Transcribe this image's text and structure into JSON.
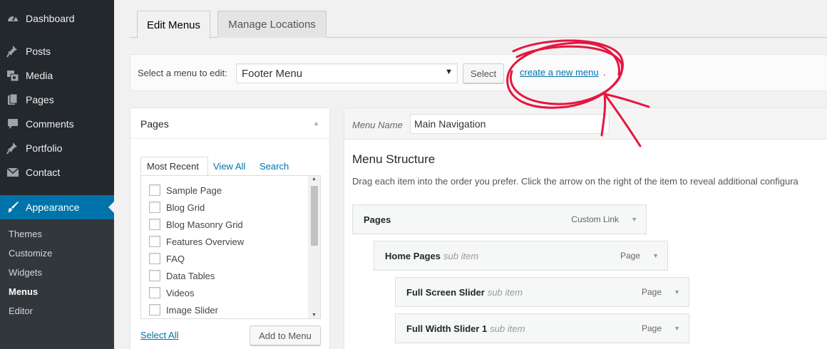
{
  "sidebar": {
    "items": [
      {
        "label": "Dashboard",
        "icon": "dashboard-icon"
      },
      {
        "label": "Posts",
        "icon": "pin-icon"
      },
      {
        "label": "Media",
        "icon": "media-icon"
      },
      {
        "label": "Pages",
        "icon": "pages-icon"
      },
      {
        "label": "Comments",
        "icon": "comment-icon"
      },
      {
        "label": "Portfolio",
        "icon": "pin-icon"
      },
      {
        "label": "Contact",
        "icon": "envelope-icon"
      },
      {
        "label": "Appearance",
        "icon": "brush-icon",
        "active": true
      }
    ],
    "submenu": [
      {
        "label": "Themes"
      },
      {
        "label": "Customize"
      },
      {
        "label": "Widgets"
      },
      {
        "label": "Menus",
        "current": true
      },
      {
        "label": "Editor"
      }
    ]
  },
  "tabs": [
    {
      "label": "Edit Menus",
      "active": true
    },
    {
      "label": "Manage Locations",
      "active": false
    }
  ],
  "manage": {
    "label": "Select a menu to edit:",
    "selected": "Footer Menu",
    "select_button": "Select",
    "create_link": "create a new menu",
    "create_suffix": "."
  },
  "pages_panel": {
    "title": "Pages",
    "tabs": [
      "Most Recent",
      "View All",
      "Search"
    ],
    "items": [
      "Sample Page",
      "Blog Grid",
      "Blog Masonry Grid",
      "Features Overview",
      "FAQ",
      "Data Tables",
      "Videos",
      "Image Slider"
    ],
    "select_all": "Select All",
    "add_button": "Add to Menu"
  },
  "menu_panel": {
    "name_label": "Menu Name",
    "name_value": "Main Navigation",
    "structure_title": "Menu Structure",
    "structure_desc": "Drag each item into the order you prefer. Click the arrow on the right of the item to reveal additional configura",
    "items": [
      {
        "title": "Pages",
        "sub": "",
        "type": "Custom Link"
      },
      {
        "title": "Home Pages",
        "sub": "sub item",
        "type": "Page"
      },
      {
        "title": "Full Screen Slider",
        "sub": "sub item",
        "type": "Page"
      },
      {
        "title": "Full Width Slider 1",
        "sub": "sub item",
        "type": "Page"
      }
    ]
  },
  "colors": {
    "sidebar_bg": "#23282d",
    "accent": "#0073aa",
    "annotation": "#e4163f"
  }
}
